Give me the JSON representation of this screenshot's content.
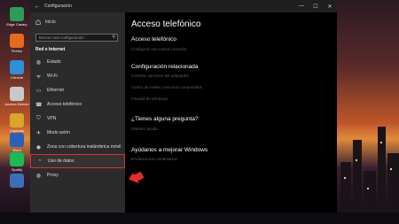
{
  "window": {
    "title": "Configuración",
    "back_label": "←",
    "minimize": "—",
    "maximize": "☐",
    "close": "✕"
  },
  "sidebar": {
    "home_label": "Inicio",
    "search_placeholder": "Buscar una configuración",
    "section_title": "Red e Internet",
    "items": [
      {
        "label": "Estado",
        "icon": "globe-icon"
      },
      {
        "label": "Wi-Fi",
        "icon": "wifi-icon"
      },
      {
        "label": "Ethernet",
        "icon": "ethernet-icon"
      },
      {
        "label": "Acceso telefónico",
        "icon": "dialup-icon"
      },
      {
        "label": "VPN",
        "icon": "vpn-icon"
      },
      {
        "label": "Modo avión",
        "icon": "airplane-icon"
      },
      {
        "label": "Zona con cobertura inalámbrica móvil",
        "icon": "hotspot-icon"
      },
      {
        "label": "Uso de datos",
        "icon": "data-usage-icon",
        "selected": true
      },
      {
        "label": "Proxy",
        "icon": "globe-icon"
      }
    ]
  },
  "content": {
    "page_title": "Acceso telefónico",
    "section1_title": "Acceso telefónico",
    "section1_link": "Configurar una nueva conexión",
    "section2_title": "Configuración relacionada",
    "related_links": [
      "Cambiar opciones del adaptador",
      "Centro de redes y recursos compartidos",
      "Firewall de Windows"
    ],
    "section3_title": "¿Tienes alguna pregunta?",
    "section3_link": "Obtener ayuda",
    "section4_title": "Ayúdanos a mejorar Windows",
    "section4_link": "Envíanos tus comentarios"
  },
  "desktop_icons": [
    {
      "label": "Edge Canary",
      "color": "#2e9b5a"
    },
    {
      "label": "Firefox",
      "color": "#e66a1e"
    },
    {
      "label": "Chrome",
      "color": "#2f8fd8"
    },
    {
      "label": "Acceso Directo",
      "color": "#c8c8c8"
    },
    {
      "label": "Capturas",
      "color": "#d9a62b"
    },
    {
      "label": "Word",
      "color": "#2b5fb8"
    },
    {
      "label": "Spotify",
      "color": "#1db954"
    },
    {
      "label": "",
      "color": "#3a6fb8"
    }
  ],
  "colors": {
    "highlight": "#e52d2d",
    "arrow": "#e52d2d"
  }
}
